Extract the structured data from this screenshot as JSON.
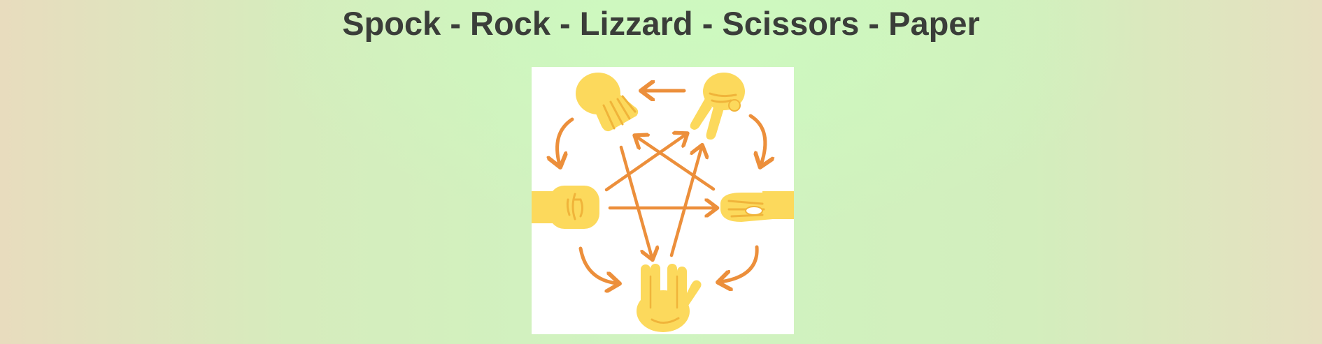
{
  "page": {
    "title": "Spock - Rock - Lizzard - Scissors - Paper"
  },
  "image": {
    "icons": [
      "paper-hand-icon",
      "scissors-hand-icon",
      "rock-fist-icon",
      "lizard-hand-icon",
      "spock-hand-icon"
    ],
    "colors": {
      "hand": "#fcd95c",
      "hand_shadow": "#f0b43a",
      "arrow": "#ec8f3b",
      "background": "#ffffff"
    }
  }
}
